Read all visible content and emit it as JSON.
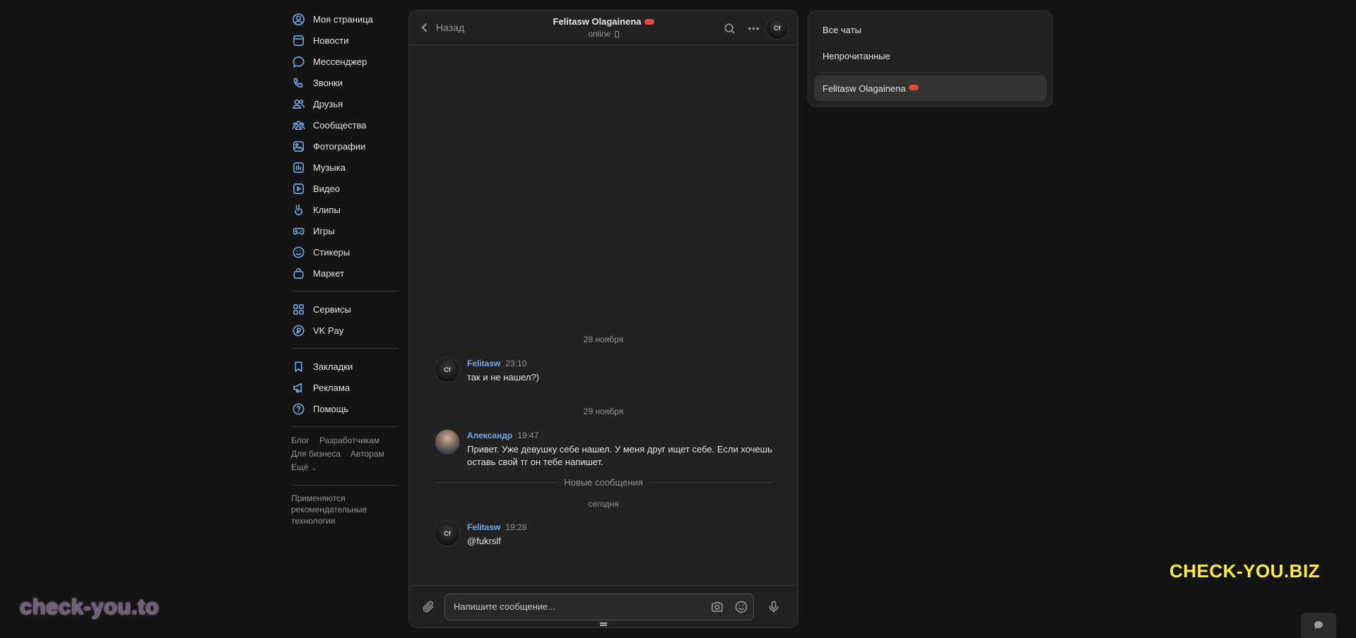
{
  "nav": {
    "main": [
      {
        "label": "Моя страница",
        "icon": "user-circle-icon"
      },
      {
        "label": "Новости",
        "icon": "newsfeed-icon"
      },
      {
        "label": "Мессенджер",
        "icon": "message-icon"
      },
      {
        "label": "Звонки",
        "icon": "phone-icon"
      },
      {
        "label": "Друзья",
        "icon": "friends-icon"
      },
      {
        "label": "Сообщества",
        "icon": "communities-icon"
      },
      {
        "label": "Фотографии",
        "icon": "photo-icon"
      },
      {
        "label": "Музыка",
        "icon": "music-icon"
      },
      {
        "label": "Видео",
        "icon": "video-icon"
      },
      {
        "label": "Клипы",
        "icon": "clips-icon"
      },
      {
        "label": "Игры",
        "icon": "gamepad-icon"
      },
      {
        "label": "Стикеры",
        "icon": "smile-icon"
      },
      {
        "label": "Маркет",
        "icon": "bag-icon"
      }
    ],
    "services": [
      {
        "label": "Сервисы",
        "icon": "services-icon"
      },
      {
        "label": "VK Pay",
        "icon": "vkpay-icon"
      }
    ],
    "extra": [
      {
        "label": "Закладки",
        "icon": "bookmark-icon"
      },
      {
        "label": "Реклама",
        "icon": "megaphone-icon"
      },
      {
        "label": "Помощь",
        "icon": "help-icon"
      }
    ],
    "footer_links": [
      "Блог",
      "Разработчикам",
      "Для бизнеса",
      "Авторам",
      "Ещё"
    ],
    "footer_note": "Применяются рекомендательные технологии"
  },
  "chat": {
    "back_label": "Назад",
    "peer_name": "Felitasw Olagainena",
    "peer_status": "online",
    "avatar_text": "Cf",
    "dates": [
      "28 ноября",
      "29 ноября",
      "сегодня"
    ],
    "new_messages_label": "Новые сообщения",
    "messages": [
      {
        "author": "Felitasw",
        "time": "23:10",
        "text": "так и не нашел?)"
      },
      {
        "author": "Александр",
        "time": "19:47",
        "text": "Привет. Уже девушку себе нашел. У меня друг ищет себе. Если хочешь оставь свой тг он тебе напишет."
      },
      {
        "author": "Felitasw",
        "time": "19:28",
        "text": "@fukrslf"
      }
    ],
    "composer_placeholder": "Напишите сообщение..."
  },
  "filter": {
    "all": "Все чаты",
    "unread": "Непрочитанные",
    "conversation": "Felitasw Olagainena"
  },
  "watermarks": {
    "left": "check-you.to",
    "right": "CHECK-YOU.BIZ"
  },
  "colors": {
    "accent": "#71aaeb",
    "background": "#141414",
    "panel": "#222222",
    "watermark_right": "#ffeb3b"
  }
}
